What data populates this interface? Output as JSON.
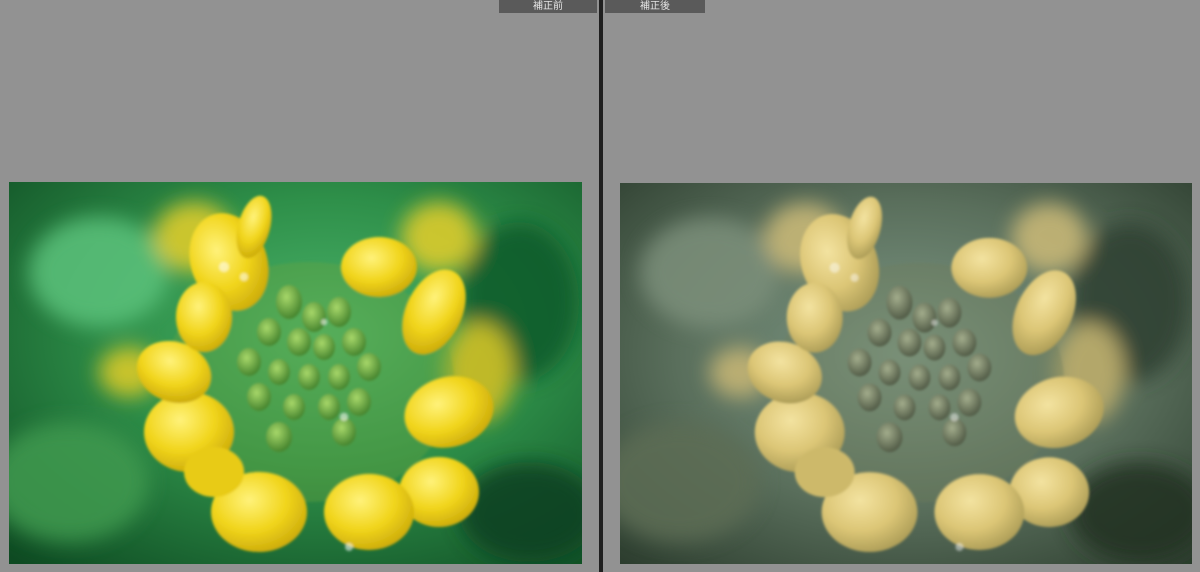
{
  "compare": {
    "before_label": "補正前",
    "after_label": "補正後"
  },
  "colors": {
    "workspace_bg": "#929292",
    "divider": "#1f1f1f",
    "label_bg": "#5a5a5a",
    "label_text": "#e6e6e6",
    "before_background": "#1f7a3c",
    "before_petal": "#e8d21a",
    "after_background": "#4f6350",
    "after_petal": "#d9c674"
  },
  "images": {
    "before": {
      "subject": "rapeseed-flower-icon"
    },
    "after": {
      "subject": "rapeseed-flower-icon"
    }
  }
}
